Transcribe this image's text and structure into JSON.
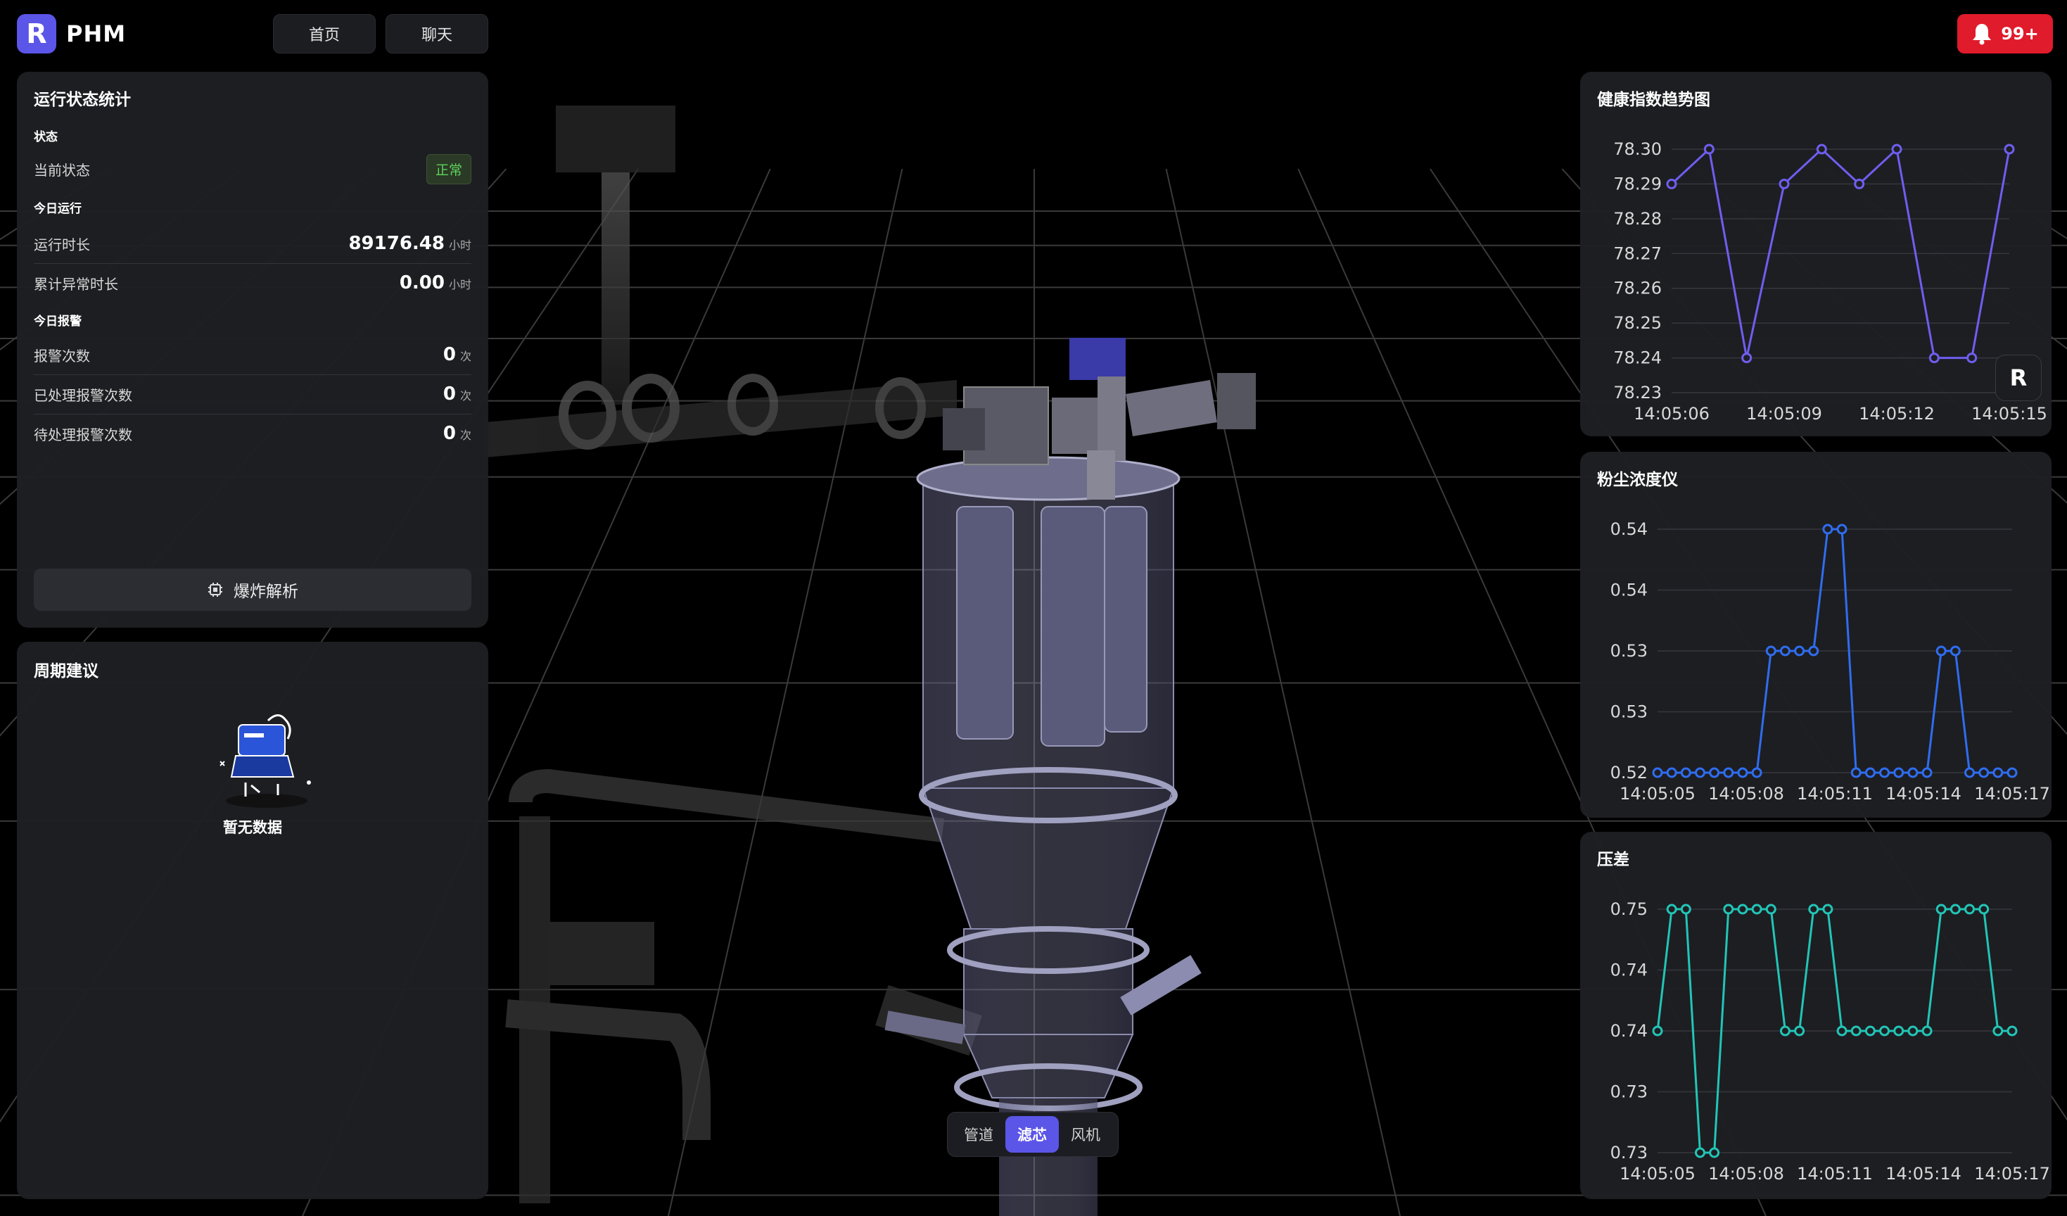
{
  "header": {
    "logo_letter": "R",
    "brand": "PHM",
    "nav": [
      "首页",
      "聊天"
    ],
    "notification_count": "99+"
  },
  "status_panel": {
    "title": "运行状态统计",
    "sections": {
      "state": "状态",
      "today_run": "今日运行",
      "today_alarm": "今日报警"
    },
    "current_state_label": "当前状态",
    "current_state_value": "正常",
    "run_rows": [
      {
        "label": "运行时长",
        "value": "89176.48",
        "unit": "小时"
      },
      {
        "label": "累计异常时长",
        "value": "0.00",
        "unit": "小时"
      }
    ],
    "alarm_rows": [
      {
        "label": "报警次数",
        "value": "0",
        "unit": "次"
      },
      {
        "label": "已处理报警次数",
        "value": "0",
        "unit": "次"
      },
      {
        "label": "待处理报警次数",
        "value": "0",
        "unit": "次"
      }
    ],
    "explode_button": "爆炸解析"
  },
  "cycle_panel": {
    "title": "周期建议",
    "empty_text": "暂无数据"
  },
  "component_toggle": {
    "options": [
      "管道",
      "滤芯",
      "风机"
    ],
    "active": "滤芯"
  },
  "floating_badge": "R",
  "colors": {
    "accent": "#5b55e8",
    "health_line": "#6f5ef0",
    "dust_line": "#2f6df0",
    "pressure_line": "#22c5b6",
    "alarm_red": "#e01b2b",
    "normal_green": "#5fd15c"
  },
  "chart_data": [
    {
      "type": "line",
      "title": "健康指数趋势图",
      "x_ticks": [
        "14:05:06",
        "14:05:09",
        "14:05:12",
        "14:05:15"
      ],
      "y_ticks": [
        "78.30",
        "78.29",
        "78.28",
        "78.27",
        "78.26",
        "78.25",
        "78.24",
        "78.23"
      ],
      "ylim": [
        78.23,
        78.3
      ],
      "series": [
        {
          "values": [
            78.29,
            78.3,
            78.24,
            78.29,
            78.3,
            78.29,
            78.3,
            78.24,
            78.24,
            78.3
          ]
        }
      ],
      "grid": true
    },
    {
      "type": "line",
      "title": "粉尘浓度仪",
      "x_ticks": [
        "14:05:05",
        "14:05:08",
        "14:05:11",
        "14:05:14",
        "14:05:17"
      ],
      "y_ticks": [
        "0.54",
        "0.54",
        "0.53",
        "0.53",
        "0.52"
      ],
      "ylim": [
        0.52,
        0.54
      ],
      "series": [
        {
          "values": [
            0.52,
            0.52,
            0.52,
            0.52,
            0.52,
            0.52,
            0.52,
            0.52,
            0.53,
            0.53,
            0.53,
            0.53,
            0.54,
            0.54,
            0.52,
            0.52,
            0.52,
            0.52,
            0.52,
            0.52,
            0.53,
            0.53,
            0.52,
            0.52,
            0.52,
            0.52
          ]
        }
      ],
      "grid": true
    },
    {
      "type": "line",
      "title": "压差",
      "x_ticks": [
        "14:05:05",
        "14:05:08",
        "14:05:11",
        "14:05:14",
        "14:05:17"
      ],
      "y_ticks": [
        "0.75",
        "0.74",
        "0.74",
        "0.73",
        "0.73"
      ],
      "ylim": [
        0.73,
        0.75
      ],
      "series": [
        {
          "values": [
            0.74,
            0.75,
            0.75,
            0.73,
            0.73,
            0.75,
            0.75,
            0.75,
            0.75,
            0.74,
            0.74,
            0.75,
            0.75,
            0.74,
            0.74,
            0.74,
            0.74,
            0.74,
            0.74,
            0.74,
            0.75,
            0.75,
            0.75,
            0.75,
            0.74,
            0.74
          ]
        }
      ],
      "grid": true
    }
  ]
}
